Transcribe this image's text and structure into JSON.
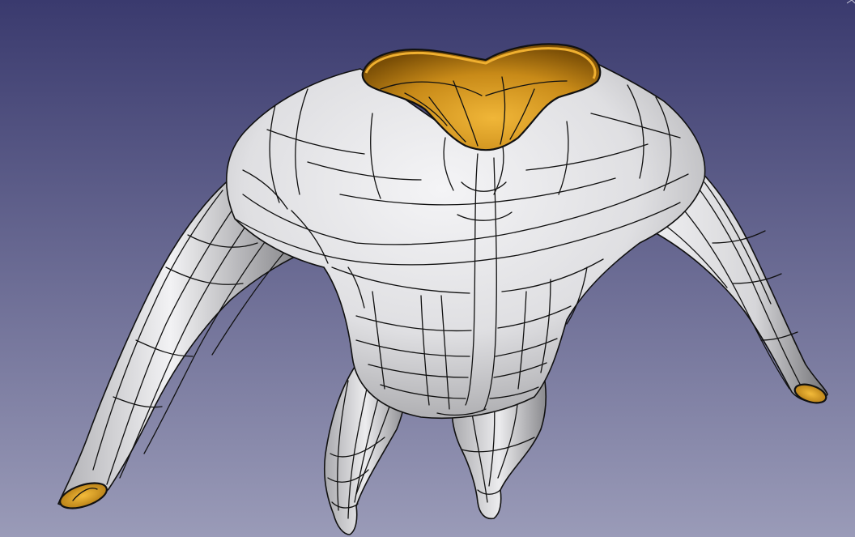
{
  "viewer": {
    "background_top_color": "#3a3a6e",
    "background_bottom_color": "#9a9bb8",
    "surface_color": "#e8e8ea",
    "surface_shadow_color": "#9c9c9f",
    "interior_color": "#e0a32a",
    "interior_dark_color": "#8a5a08",
    "edge_color": "#111111"
  },
  "model": {
    "icon": "shell-body-mesh-icon",
    "openings": [
      "neck-opening",
      "left-wrist-opening",
      "right-wrist-opening"
    ]
  }
}
